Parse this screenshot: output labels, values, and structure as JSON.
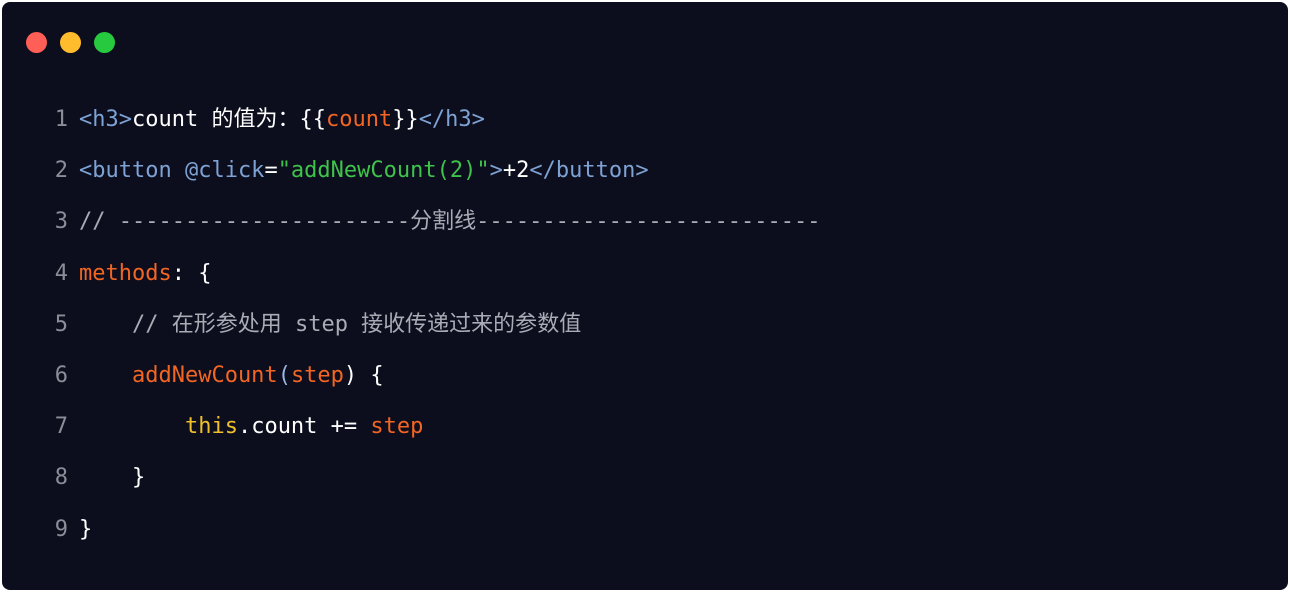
{
  "window": {
    "controls": [
      "close",
      "minimize",
      "maximize"
    ],
    "colors": {
      "background": "#0c0e1e",
      "close": "#ff5f56",
      "minimize": "#ffbd2e",
      "maximize": "#27c93f"
    }
  },
  "code": {
    "language": "vue",
    "lines": [
      {
        "number": "1",
        "tokens": [
          {
            "text": "<h3>",
            "type": "tag"
          },
          {
            "text": "count 的值为：{{",
            "type": "plain"
          },
          {
            "text": "count",
            "type": "var"
          },
          {
            "text": "}}",
            "type": "plain"
          },
          {
            "text": "</h3>",
            "type": "tag"
          }
        ]
      },
      {
        "number": "2",
        "tokens": [
          {
            "text": "<button @click",
            "type": "tag"
          },
          {
            "text": "=",
            "type": "plain"
          },
          {
            "text": "\"addNewCount(2)\"",
            "type": "str"
          },
          {
            "text": ">",
            "type": "tag"
          },
          {
            "text": "+2",
            "type": "plain"
          },
          {
            "text": "</button>",
            "type": "tag"
          }
        ]
      },
      {
        "number": "3",
        "tokens": [
          {
            "text": "// ----------------------分割线--------------------------",
            "type": "comment"
          }
        ]
      },
      {
        "number": "4",
        "tokens": [
          {
            "text": "methods",
            "type": "var"
          },
          {
            "text": ": {",
            "type": "plain"
          }
        ]
      },
      {
        "number": "5",
        "tokens": [
          {
            "text": "    // 在形参处用 step 接收传递过来的参数值",
            "type": "comment"
          }
        ]
      },
      {
        "number": "6",
        "tokens": [
          {
            "text": "    addNewCount",
            "type": "var"
          },
          {
            "text": "(",
            "type": "punc"
          },
          {
            "text": "step",
            "type": "var"
          },
          {
            "text": ") {",
            "type": "plain"
          }
        ]
      },
      {
        "number": "7",
        "tokens": [
          {
            "text": "        this",
            "type": "kw"
          },
          {
            "text": ".count += ",
            "type": "plain"
          },
          {
            "text": "step",
            "type": "var"
          }
        ]
      },
      {
        "number": "8",
        "tokens": [
          {
            "text": "    }",
            "type": "plain"
          }
        ]
      },
      {
        "number": "9",
        "tokens": [
          {
            "text": "}",
            "type": "plain"
          }
        ]
      }
    ]
  }
}
